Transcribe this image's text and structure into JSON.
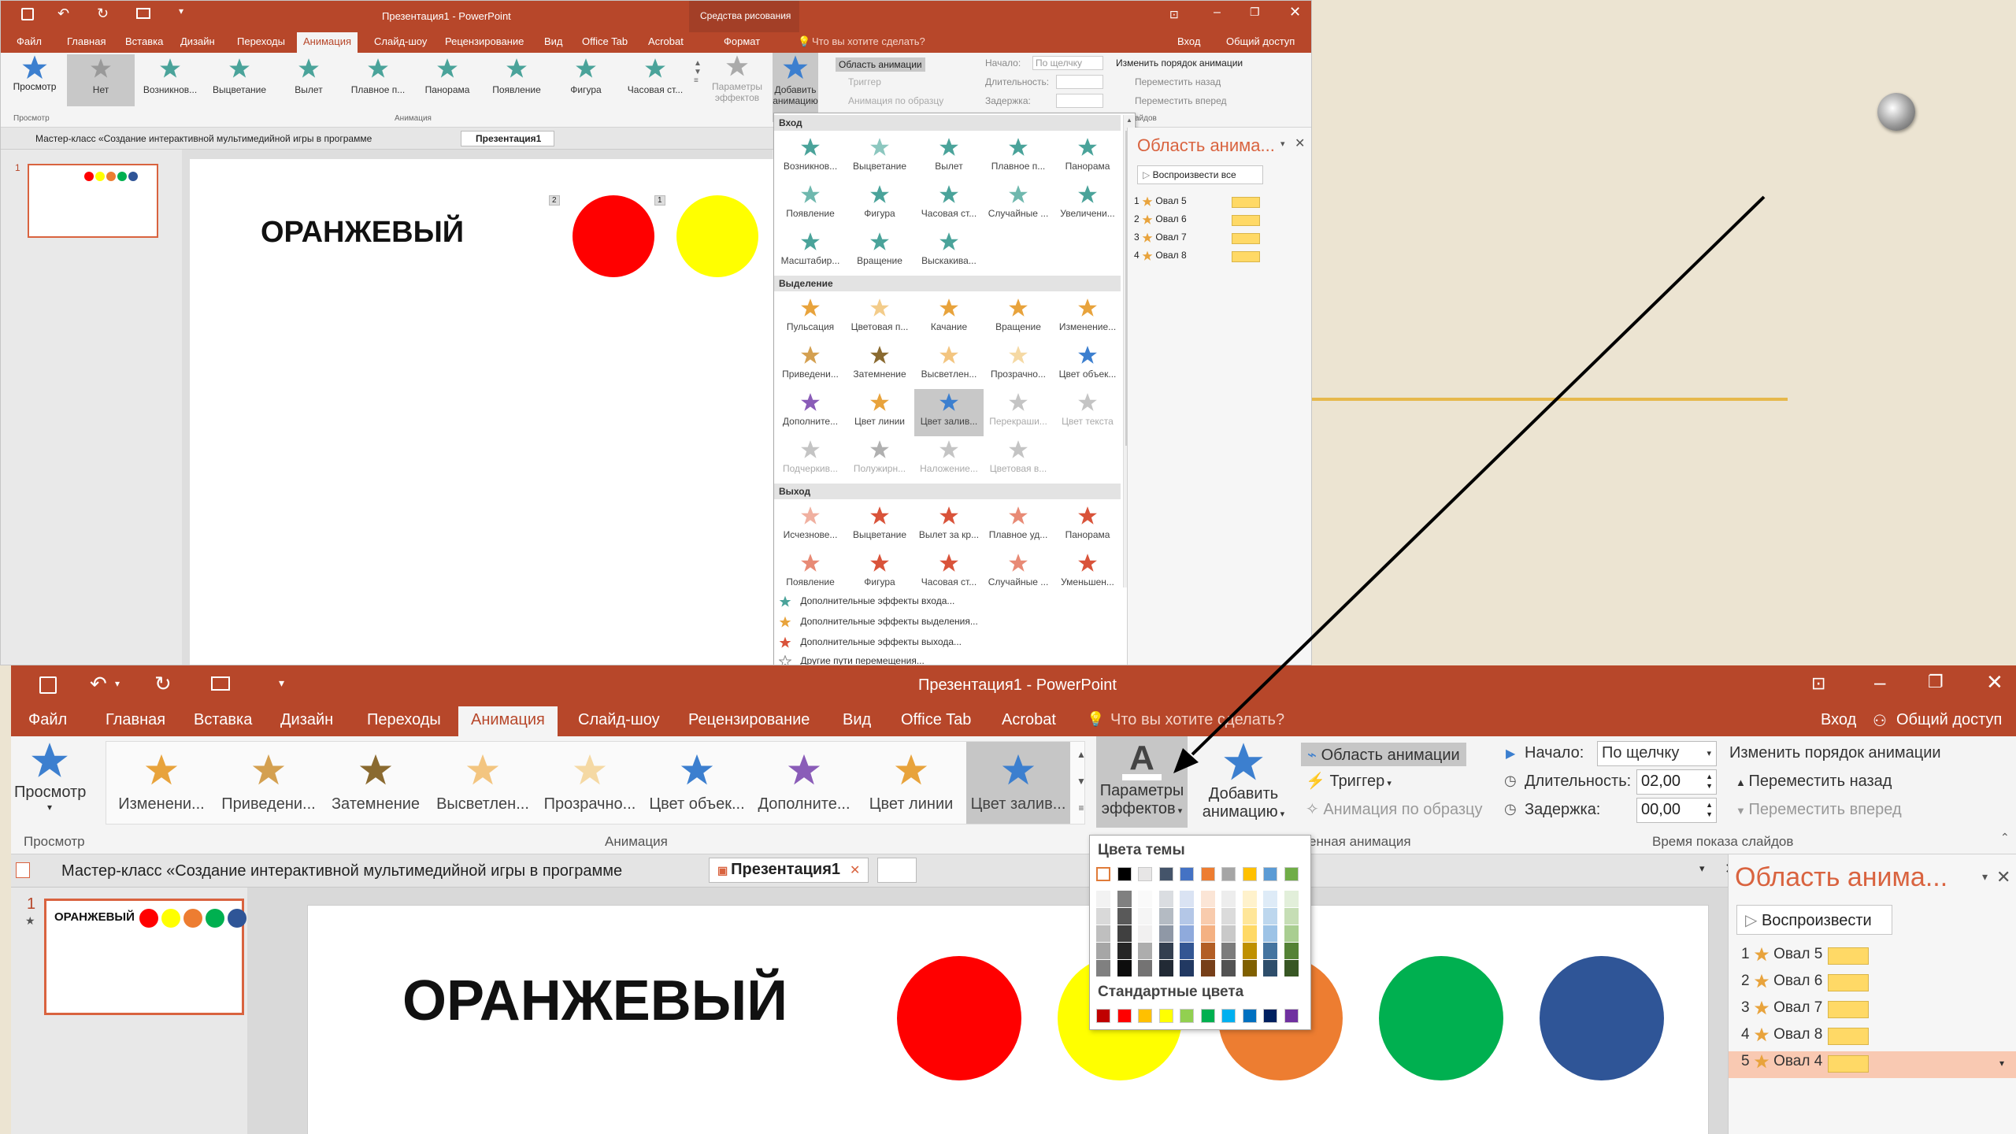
{
  "colors": {
    "accent": "#b7472a",
    "red": "#ff0000",
    "yellow": "#ffff00",
    "orange": "#ed7d31",
    "green": "#00b050",
    "blue": "#2f5597",
    "timeline_bar": "#ffd966"
  },
  "background": {
    "line_color": "#e6b84c"
  },
  "back_window": {
    "title": "Презентация1 - PowerPoint",
    "drawing_tools": "Средства рисования",
    "format_tab": "Формат",
    "tell_me": "Что вы хотите сделать?",
    "signin": "Вход",
    "share": "Общий доступ",
    "tabs": [
      "Файл",
      "Главная",
      "Вставка",
      "Дизайн",
      "Переходы",
      "Анимация",
      "Слайд-шоу",
      "Рецензирование",
      "Вид",
      "Office Tab",
      "Acrobat"
    ],
    "active_tab": "Анимация",
    "preview_label": "Просмотр",
    "preview_group": "Просмотр",
    "animation_group": "Анимация",
    "gallery": [
      "Нет",
      "Возникнов...",
      "Выцветание",
      "Вылет",
      "Плавное п...",
      "Панорама",
      "Появление",
      "Фигура",
      "Часовая ст..."
    ],
    "effect_options": "Параметры эффектов",
    "add_animation": "Добавить анимацию",
    "animation_pane_btn": "Область анимации",
    "trigger": "Триггер",
    "animation_painter": "Анимация по образцу",
    "start_label": "Начало:",
    "start_value": "По щелчку",
    "duration_label": "Длительность:",
    "delay_label": "Задержка:",
    "reorder": "Изменить порядок анимации",
    "move_back": "Переместить назад",
    "move_forward": "Переместить вперед",
    "timing_group": "айдов",
    "doc_tab_1": "Мастер-класс «Создание интерактивной мультимедийной игры в программе",
    "doc_tab_2": "Презентация1",
    "slide_number": "1",
    "slide_text": "ОРАНЖЕВЫЙ",
    "slide_tag_1": "2",
    "slide_tag_2": "1",
    "dropdown": {
      "entrance_header": "Вход",
      "entrance": [
        "Возникнов...",
        "Выцветание",
        "Вылет",
        "Плавное п...",
        "Панорама",
        "Появление",
        "Фигура",
        "Часовая ст...",
        "Случайные ...",
        "Увеличени...",
        "Масштабир...",
        "Вращение",
        "Выскакива..."
      ],
      "emphasis_header": "Выделение",
      "emphasis": [
        "Пульсация",
        "Цветовая п...",
        "Качание",
        "Вращение",
        "Изменение...",
        "Приведени...",
        "Затемнение",
        "Высветлен...",
        "Прозрачно...",
        "Цвет объек...",
        "Дополните...",
        "Цвет линии",
        "Цвет залив...",
        "Перекраши...",
        "Цвет текста",
        "Подчеркив...",
        "Полужирн...",
        "Наложение...",
        "Цветовая в..."
      ],
      "exit_header": "Выход",
      "exit": [
        "Исчезнове...",
        "Выцветание",
        "Вылет за кр...",
        "Плавное уд...",
        "Панорама",
        "Появление",
        "Фигура",
        "Часовая ст...",
        "Случайные ...",
        "Уменьшен..."
      ],
      "more_entrance": "Дополнительные эффекты входа...",
      "more_emphasis": "Дополнительные эффекты выделения...",
      "more_exit": "Дополнительные эффекты выхода...",
      "more_paths": "Другие пути перемещения..."
    },
    "pane_title": "Область анима...",
    "pane_play": "Воспроизвести все",
    "pane_items": [
      {
        "n": "1",
        "label": "Овал 5"
      },
      {
        "n": "2",
        "label": "Овал 6"
      },
      {
        "n": "3",
        "label": "Овал 7"
      },
      {
        "n": "4",
        "label": "Овал 8"
      }
    ]
  },
  "front_window": {
    "title": "Презентация1 - PowerPoint",
    "tell_me": "Что вы хотите сделать?",
    "signin": "Вход",
    "share": "Общий доступ",
    "tabs": [
      "Файл",
      "Главная",
      "Вставка",
      "Дизайн",
      "Переходы",
      "Анимация",
      "Слайд-шоу",
      "Рецензирование",
      "Вид",
      "Office Tab",
      "Acrobat"
    ],
    "active_tab": "Анимация",
    "preview_label": "Просмотр",
    "preview_group": "Просмотр",
    "animation_group": "Анимация",
    "gallery": [
      "Изменени...",
      "Приведени...",
      "Затемнение",
      "Высветлен...",
      "Прозрачно...",
      "Цвет объек...",
      "Дополните...",
      "Цвет линии",
      "Цвет залив..."
    ],
    "gallery_selected": "Цвет залив...",
    "effect_options_1": "Параметры",
    "effect_options_2": "эффектов",
    "add_animation_1": "Добавить",
    "add_animation_2": "анимацию",
    "animation_pane_btn": "Область анимации",
    "trigger": "Триггер",
    "animation_painter": "Анимация по образцу",
    "advanced_group": "енная анимация",
    "start_label": "Начало:",
    "start_value": "По щелчку",
    "duration_label": "Длительность:",
    "duration_value": "02,00",
    "delay_label": "Задержка:",
    "delay_value": "00,00",
    "reorder": "Изменить порядок анимации",
    "move_back": "Переместить назад",
    "move_forward": "Переместить вперед",
    "timing_group": "Время показа слайдов",
    "doc_tab_1": "Мастер-класс «Создание интерактивной мультимедийной игры в программе",
    "doc_tab_2": "Презентация1",
    "slide_number": "1",
    "thumb_text": "ОРАНЖЕВЫЙ",
    "slide_text": "ОРАНЖЕВЫЙ",
    "picker": {
      "theme_header": "Цвета темы",
      "standard_header": "Стандартные цвета",
      "theme_top": [
        "#ffffff",
        "#000000",
        "#e7e6e6",
        "#44546a",
        "#4472c4",
        "#ed7d31",
        "#a5a5a5",
        "#ffc000",
        "#5b9bd5",
        "#70ad47"
      ],
      "standard": [
        "#c00000",
        "#ff0000",
        "#ffc000",
        "#ffff00",
        "#92d050",
        "#00b050",
        "#00b0f0",
        "#0070c0",
        "#002060",
        "#7030a0"
      ]
    },
    "pane_title": "Область анима...",
    "pane_play": "Воспроизвести",
    "pane_items": [
      {
        "n": "1",
        "label": "Овал 5"
      },
      {
        "n": "2",
        "label": "Овал 6"
      },
      {
        "n": "3",
        "label": "Овал 7"
      },
      {
        "n": "4",
        "label": "Овал 8"
      },
      {
        "n": "5",
        "label": "Овал 4"
      }
    ]
  }
}
